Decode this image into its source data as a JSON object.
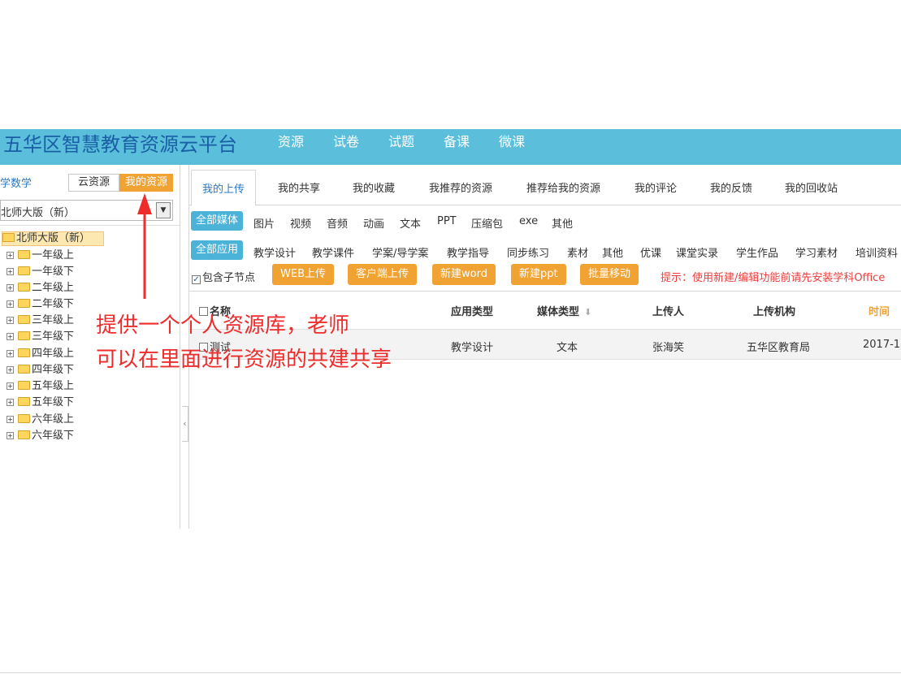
{
  "header": {
    "title": "五华区智慧教育资源云平台",
    "nav": [
      "资源",
      "试卷",
      "试题",
      "备课",
      "微课"
    ]
  },
  "sidebar": {
    "subject": "学数学",
    "cloud_btn": "云资源",
    "my_btn": "我的资源",
    "edition": "北师大版（新）",
    "tree_root": "北师大版（新）",
    "tree_nodes": [
      "一年级上",
      "一年级下",
      "二年级上",
      "二年级下",
      "三年级上",
      "三年级下",
      "四年级上",
      "四年级下",
      "五年级上",
      "五年级下",
      "六年级上",
      "六年级下"
    ]
  },
  "tabs": [
    "我的上传",
    "我的共享",
    "我的收藏",
    "我推荐的资源",
    "推荐给我的资源",
    "我的评论",
    "我的反馈",
    "我的回收站"
  ],
  "media_filters": [
    "全部媒体",
    "图片",
    "视频",
    "音频",
    "动画",
    "文本",
    "PPT",
    "压缩包",
    "exe",
    "其他"
  ],
  "app_filters": [
    "全部应用",
    "教学设计",
    "教学课件",
    "学案/导学案",
    "教学指导",
    "同步练习",
    "素材",
    "其他",
    "优课",
    "课堂实录",
    "学生作品",
    "学习素材",
    "培训资料"
  ],
  "actions": {
    "include_child": "包含子节点",
    "include_child_checked": true,
    "buttons": [
      "WEB上传",
      "客户端上传",
      "新建word",
      "新建ppt",
      "批量移动"
    ],
    "hint": "提示：使用新建/编辑功能前请先安装学科Office"
  },
  "table": {
    "headers": {
      "name": "名称",
      "app_type": "应用类型",
      "media_type": "媒体类型",
      "uploader": "上传人",
      "org": "上传机构",
      "time": "时间"
    },
    "rows": [
      {
        "name": "测试",
        "app_type": "教学设计",
        "media_type": "文本",
        "uploader": "张海笑",
        "org": "五华区教育局",
        "time": "2017-1"
      }
    ]
  },
  "annotation": {
    "line1": "提供一个个人资源库，老师",
    "line2": "可以在里面进行资源的共建共享"
  },
  "colors": {
    "header_bg": "#5bbfdc",
    "title": "#1a5fa6",
    "accent_orange": "#f0a232",
    "accent_blue": "#4bb2d8",
    "annotation_red": "#ee2c2c"
  }
}
